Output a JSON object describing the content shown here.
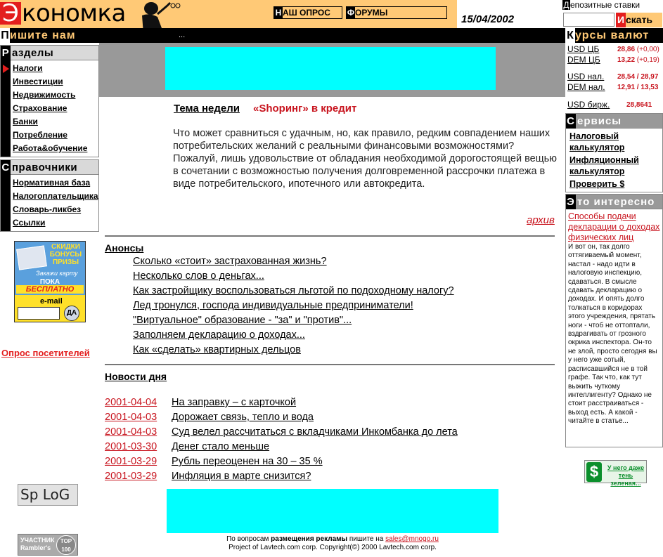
{
  "header": {
    "logo_cap": "Э",
    "logo_rest": "кономка",
    "poll_cap": "Н",
    "poll_rest": "АШ ОПРОС",
    "forums_cap": "Ф",
    "forums_rest": "ОРУМЫ",
    "date": "15/04/2002",
    "deposit_cap": "Д",
    "deposit_rest": "епозитные ставки",
    "search_cap": "И",
    "search_rest": "скать"
  },
  "bar": {
    "write_cap": "П",
    "write_rest": "ишите нам",
    "dots": "...",
    "rates_cap": "К",
    "rates_rest": "урсы валют"
  },
  "sections": {
    "cap": "Р",
    "title": "азделы",
    "items": [
      "Налоги",
      "Инвестиции",
      "Недвижимость",
      "Страхование",
      "Банки",
      "Потребление",
      "Работа&обучение"
    ]
  },
  "reference": {
    "cap": "С",
    "title": "правочники",
    "items": [
      "Нормативная база",
      "Налогоплательщика",
      "Словарь-ликбез",
      "Ссылки"
    ]
  },
  "promo": {
    "badge": "СКИДКИ БОНУСЫ ПРИЗЫ",
    "order": "Закажи карту",
    "free1": "ПОКА",
    "free2": "БЕСПЛАТНО",
    "email": "e-mail",
    "yes": "ДА"
  },
  "poll_link": "Опрос посетителей",
  "splog": "Sp LoG",
  "rambler": {
    "line1": "УЧАСТНИК",
    "line2": "Rambler's",
    "top": "TOP 100"
  },
  "theme": {
    "label": "Тема недели",
    "title": "«Shopинг» в кредит",
    "text": "Что может сравниться с удачным, но, как правило, редким совпадением наших потребительских желаний с реальными финансовыми возможностями? Пожалуй, лишь удовольствие от обладания необходимой дорогостоящей вещью в сочетании с возможностью получения долговременной рассрочки платежа в виде потребительского, ипотечного или автокредита.",
    "archive": "архив"
  },
  "anons": {
    "title": "Анонсы",
    "items": [
      "Сколько «стоит» застрахованная жизнь? ",
      "Несколько слов о деньгах... ",
      "Как застройщику воспользоваться льготой по подоходному налогу? ",
      "Лед тронулся, господа индивидуальные предприниматели! ",
      "\"Виртуальное\" образование - \"за\" и \"против\"... ",
      "Заполняем декларацию о доходах... ",
      "Как «сделать» квартирных дельцов "
    ]
  },
  "news": {
    "title": "Новости дня",
    "items": [
      {
        "date": "2001-04-04",
        "text": "На заправку – с карточкой "
      },
      {
        "date": "2001-04-03",
        "text": "Дорожает связь, тепло и вода "
      },
      {
        "date": "2001-04-03",
        "text": "Суд велел рассчитаться с вкладчиками Инкомбанка до лета "
      },
      {
        "date": "2001-03-30",
        "text": "Денег стало меньше "
      },
      {
        "date": "2001-03-29",
        "text": "Рубль переоценен на 30 – 35 % "
      },
      {
        "date": "2001-03-29",
        "text": "Инфляция в марте снизится?"
      }
    ]
  },
  "footer": {
    "line1_a": "По вопросам ",
    "line1_b": "размещения рекламы",
    "line1_c": " пишите на ",
    "email": "sales@mnogo.ru",
    "line2": "Project of Lavtech.com corp. Copyright(©) 2000 Lavtech.com corp."
  },
  "rates": [
    {
      "name": "USD ЦБ",
      "value": "28,86",
      "change": " (+0,00)"
    },
    {
      "name": "DEM ЦБ",
      "value": "13,22",
      "change": " (+0,19)"
    },
    {
      "name": "USD нал.",
      "value": "28,54 / 28,97",
      "change": ""
    },
    {
      "name": "DEM нал.",
      "value": "12,91 / 13,53",
      "change": ""
    },
    {
      "name": "USD бирж.",
      "value": "28,8641",
      "change": ""
    }
  ],
  "services": {
    "cap": "С",
    "title": "ервисы",
    "items": [
      "Налоговый калькулятор",
      "Инфляционный калькулятор",
      "Проверить $"
    ]
  },
  "interest": {
    "cap": "Э",
    "title": "то интересно",
    "link": "Способы подачи декларации о доходах физических лиц",
    "text": "И вот он, так долго оттягиваемый момент, настал - надо идти в налоговую инспекцию, сдаваться. В смысле сдавать декларацию о доходах. И опять долго толкаться в коридорах этого учреждения, прятать ноги - чтоб не оттоптали, вздрагивать от грозного окрика инспектора. Он-то не злой, просто сегодня вы у него уже сотый, расписавшийся не в той графе. Так что, как тут выжить чуткому интеллигенту? Однако не стоит расстраиваться - выход есть. А какой - читайте в статье..."
  },
  "dollar": {
    "sign": "$",
    "text": "У него даже тень зеленая..."
  },
  "colors": {
    "accent": "#ffc976",
    "red": "#e31e1e",
    "banner": "#00ffff"
  }
}
